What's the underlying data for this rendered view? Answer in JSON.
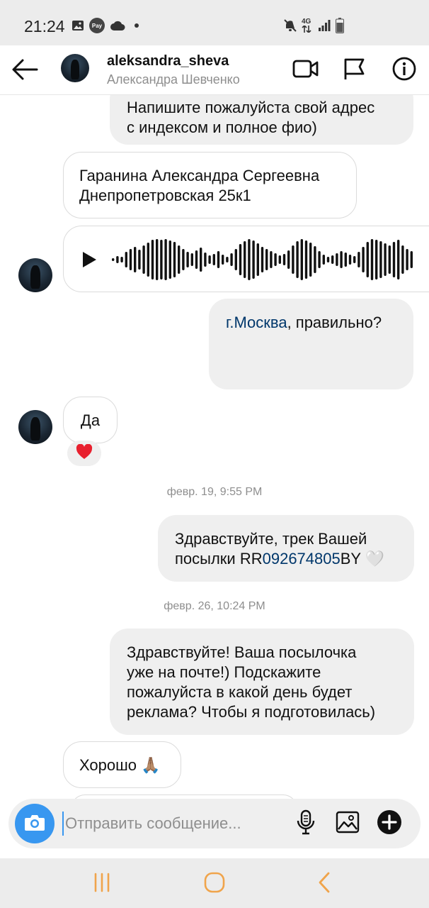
{
  "status_bar": {
    "time": "21:24",
    "network": "4G",
    "icons": [
      "gallery-icon",
      "samsung-pay-icon",
      "cloud-icon",
      "dot-icon",
      "mute-icon",
      "signal-icon",
      "battery-icon"
    ]
  },
  "header": {
    "username": "aleksandra_sheva",
    "display_name": "Александра Шевченко",
    "icons": [
      "back-arrow-icon",
      "video-call-icon",
      "flag-icon",
      "info-icon"
    ]
  },
  "messages": [
    {
      "direction": "out",
      "lines": [
        "Напишите пожалуйста свой адрес",
        "с индексом и полное фио)"
      ]
    },
    {
      "direction": "in",
      "lines": [
        "Гаранина Александра Сергеевна",
        "Днепропетровская 25к1"
      ]
    },
    {
      "direction": "in",
      "type": "voice"
    },
    {
      "direction": "out",
      "link_text": "г.Москва",
      "text_after": ", правильно?"
    },
    {
      "direction": "in",
      "text": "Да",
      "reaction": "❤️"
    },
    {
      "direction": "out",
      "line1": "Здравствуйте, трек Вашей",
      "line2_prefix": "посылки RR",
      "line2_link": "092674805",
      "line2_suffix": "BY 🤍"
    },
    {
      "direction": "out",
      "lines": [
        "Здравствуйте! Ваша посылочка",
        "уже на почте!) Подскажите",
        "пожалуйста в какой день будет",
        "реклама? Чтобы я подготовилась)"
      ]
    },
    {
      "direction": "in",
      "text": "Хорошо 🙏🏽"
    }
  ],
  "timestamps": [
    "февр. 19, 9:55 PM",
    "февр. 26, 10:24 PM"
  ],
  "composer": {
    "placeholder": "Отправить сообщение...",
    "icons": [
      "camera-icon",
      "microphone-icon",
      "image-icon",
      "plus-icon"
    ]
  },
  "colors": {
    "accent_blue": "#3897f0",
    "link": "#00376b",
    "bubble_gray": "#efefef",
    "nav_orange": "#f0a44b"
  }
}
